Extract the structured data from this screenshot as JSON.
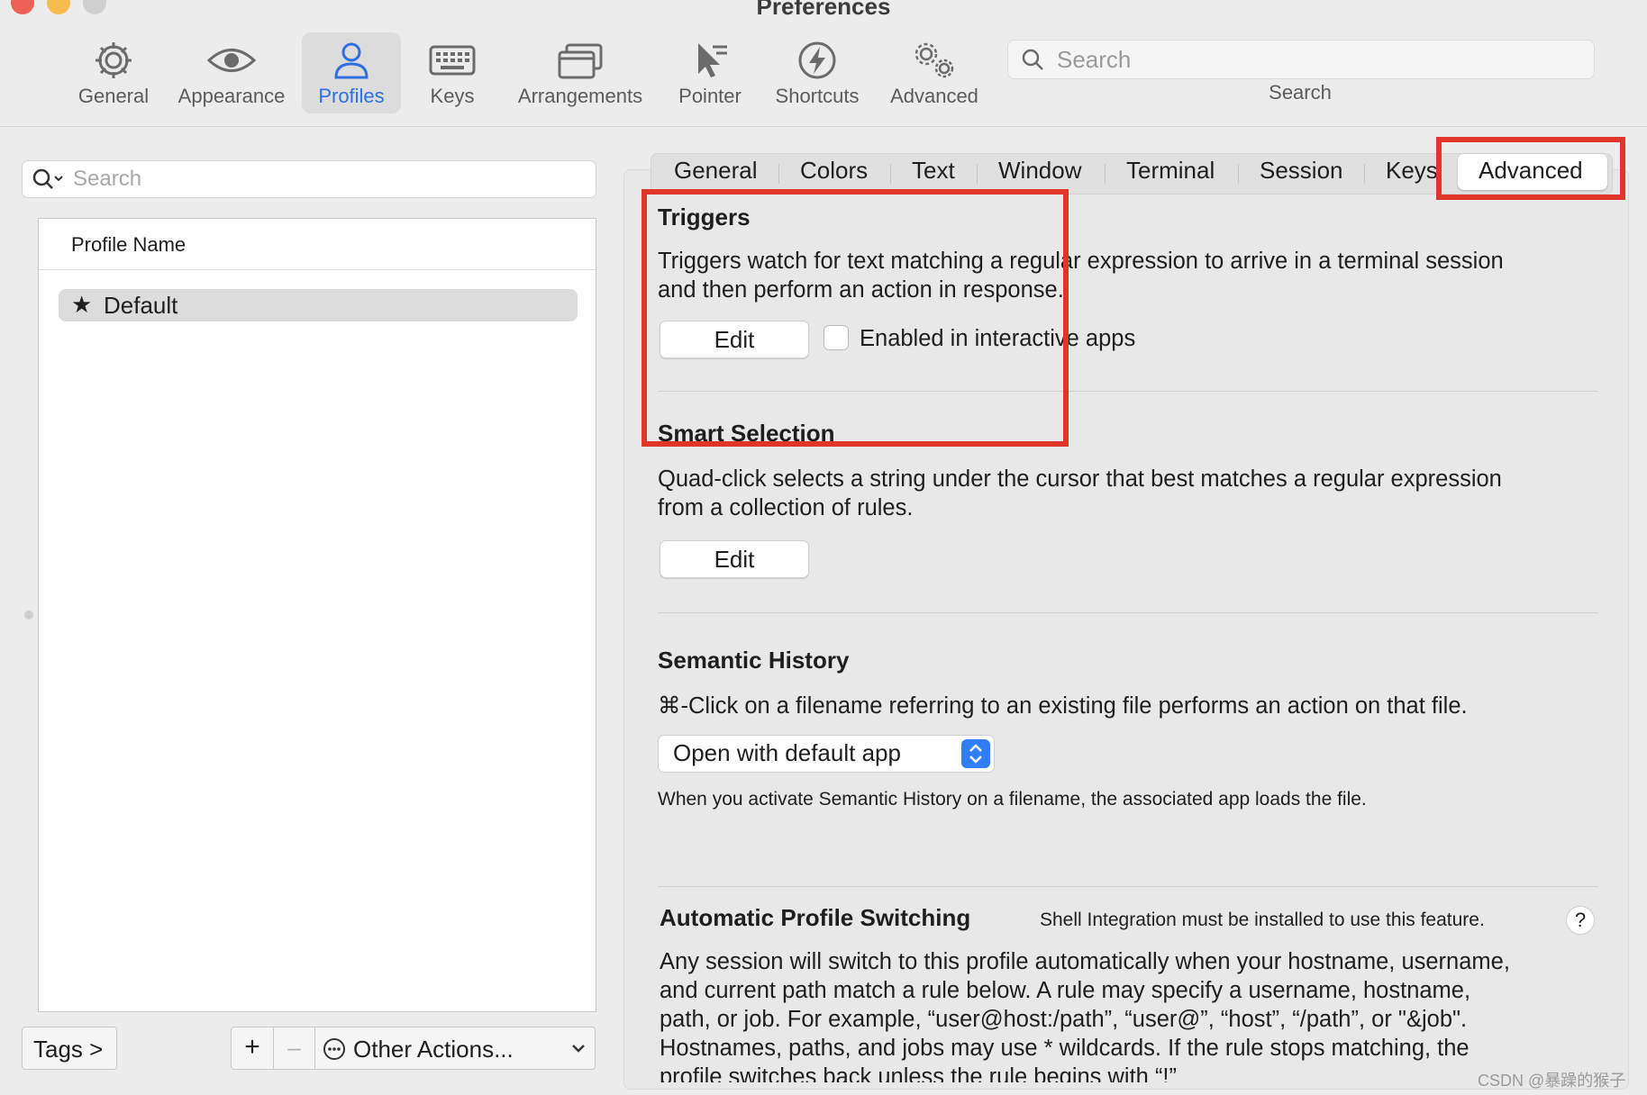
{
  "window": {
    "title": "Preferences"
  },
  "toolbar": {
    "items": [
      {
        "label": "General",
        "icon": "gear-icon"
      },
      {
        "label": "Appearance",
        "icon": "eye-icon"
      },
      {
        "label": "Profiles",
        "icon": "person-icon",
        "active": true
      },
      {
        "label": "Keys",
        "icon": "keyboard-icon"
      },
      {
        "label": "Arrangements",
        "icon": "windows-icon"
      },
      {
        "label": "Pointer",
        "icon": "pointer-icon"
      },
      {
        "label": "Shortcuts",
        "icon": "lightning-icon"
      },
      {
        "label": "Advanced",
        "icon": "gears-icon"
      }
    ],
    "search": {
      "placeholder": "Search",
      "label": "Search"
    }
  },
  "sidebar": {
    "search_placeholder": "Search",
    "column_header": "Profile Name",
    "profiles": [
      {
        "name": "Default",
        "default": true
      }
    ],
    "tags_button": "Tags >",
    "add_button": "+",
    "remove_button": "–",
    "other_actions": "Other Actions..."
  },
  "tabs": [
    "General",
    "Colors",
    "Text",
    "Window",
    "Terminal",
    "Session",
    "Keys",
    "Advanced"
  ],
  "active_tab": "Advanced",
  "triggers": {
    "title": "Triggers",
    "description_line1": "Triggers watch for text matching a regular expression to arrive in a terminal session",
    "description_line2": "and then perform an action in response.",
    "edit_button": "Edit",
    "checkbox_label": "Enabled in interactive apps",
    "checkbox_checked": false
  },
  "smart_selection": {
    "title": "Smart Selection",
    "description_line1": "Quad-click selects a string under the cursor that best matches a regular expression",
    "description_line2": "from a collection of rules.",
    "edit_button": "Edit"
  },
  "semantic_history": {
    "title": "Semantic History",
    "description": "⌘-Click on a filename referring to an existing file performs an action on that file.",
    "selected_option": "Open with default app",
    "note": "When you activate Semantic History on a filename, the associated app loads the file."
  },
  "auto_profile_switching": {
    "title": "Automatic Profile Switching",
    "note": "Shell Integration must be installed to use this feature.",
    "help": "?",
    "lines": [
      "Any session will switch to this profile automatically when your hostname, username,",
      "and current path match a rule below. A rule may specify a username, hostname,",
      "path, or job. For example, “user@host:/path”, “user@”, “host”, “/path”, or \"&job\".",
      "Hostnames, paths, and jobs may use * wildcards. If the rule stops matching, the",
      "profile switches back unless the rule begins with “!”"
    ]
  },
  "watermark": "CSDN @暴躁的猴子",
  "colors": {
    "accent": "#2f6fe0",
    "highlight": "#e0352b",
    "close": "#ee5f57",
    "minimize": "#f5bd4f",
    "zoom": "#cfcfcf"
  }
}
